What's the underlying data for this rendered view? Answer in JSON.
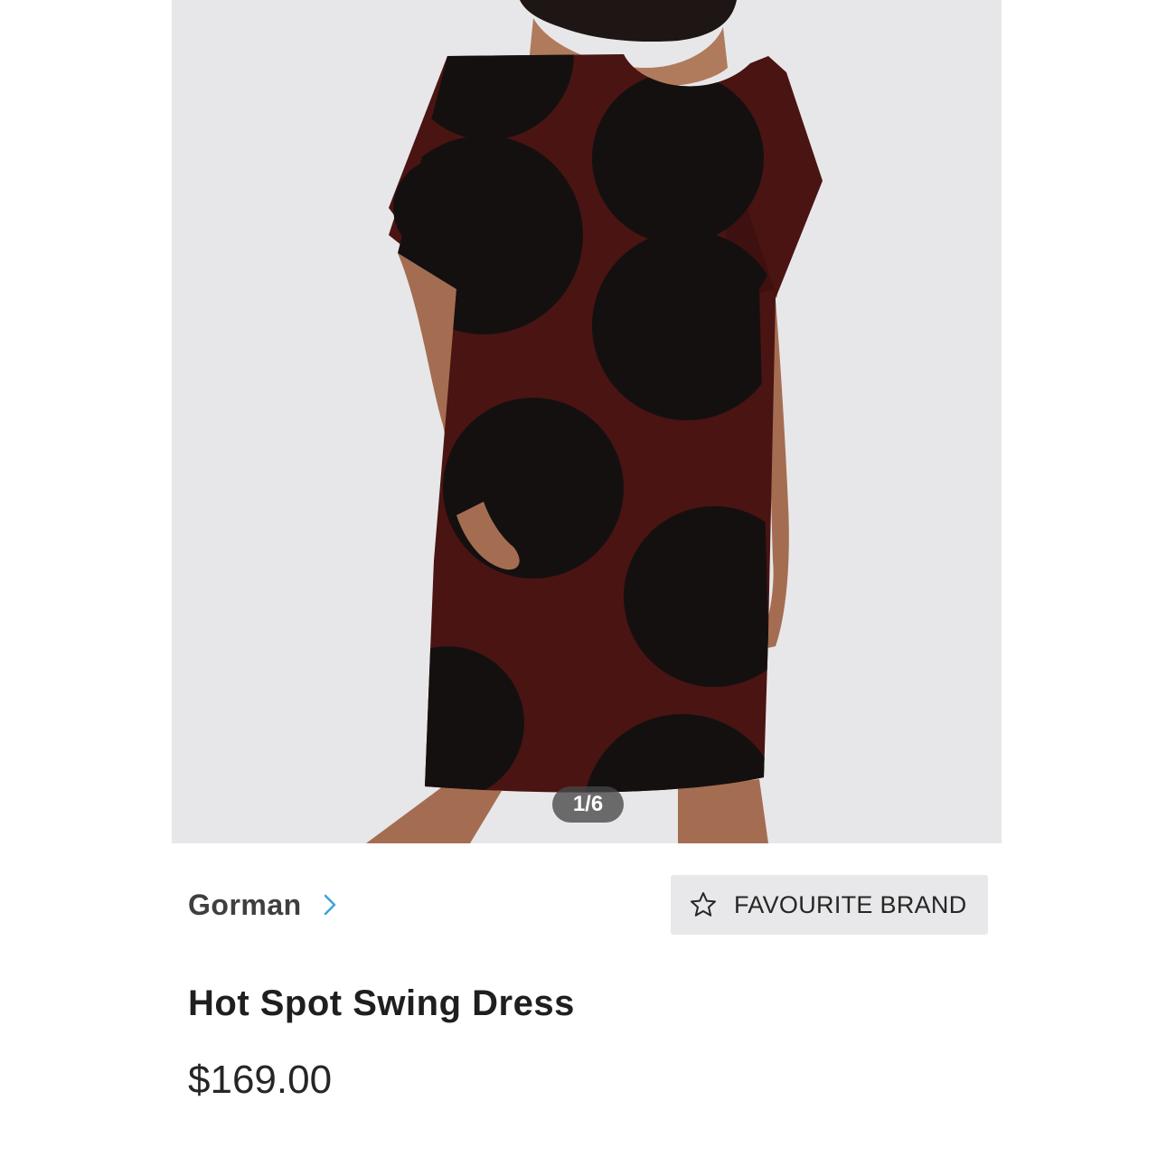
{
  "gallery": {
    "image_label": "product-photo-dress",
    "counter": "1/6",
    "current_index": 1,
    "total": 6
  },
  "brand": {
    "name": "Gorman",
    "chevron_icon": "chevron-right-icon",
    "chevron_color": "#3aa3d8"
  },
  "favourite": {
    "label": "FAVOURITE BRAND",
    "icon": "star-outline-icon"
  },
  "product": {
    "title": "Hot Spot Swing Dress",
    "price": "$169.00"
  },
  "colors": {
    "image_background": "#e7e7e9",
    "dress_maroon": "#4a1412",
    "dress_spot": "#151010",
    "button_background": "#e8e8ea"
  }
}
